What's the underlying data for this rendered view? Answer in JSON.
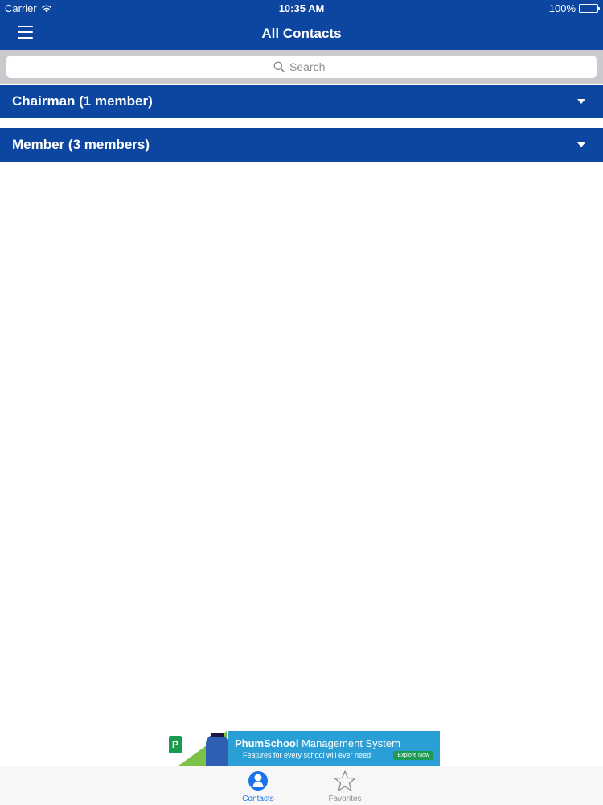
{
  "status_bar": {
    "carrier": "Carrier",
    "time": "10:35 AM",
    "battery": "100%"
  },
  "nav": {
    "title": "All Contacts",
    "menu_icon": "hamburger-icon"
  },
  "search": {
    "placeholder": "Search",
    "icon": "search-icon"
  },
  "groups": [
    {
      "label": "Chairman (1 member)",
      "icon": "chevron-down-icon"
    },
    {
      "label": "Member (3 members)",
      "icon": "chevron-down-icon"
    }
  ],
  "ad": {
    "brand": "PhumSchool",
    "title_rest": " Management System",
    "subtitle": "Features for every school will ever need",
    "cta": "Explore Now",
    "logo_letter": "P"
  },
  "tabbar": {
    "tabs": [
      {
        "label": "Contacts",
        "icon": "person-icon",
        "active": true
      },
      {
        "label": "Favorites",
        "icon": "star-icon",
        "active": false
      }
    ]
  },
  "colors": {
    "brand_blue": "#0c46a0",
    "active_tab": "#1a73e8",
    "inactive_tab": "#8e8e93"
  }
}
